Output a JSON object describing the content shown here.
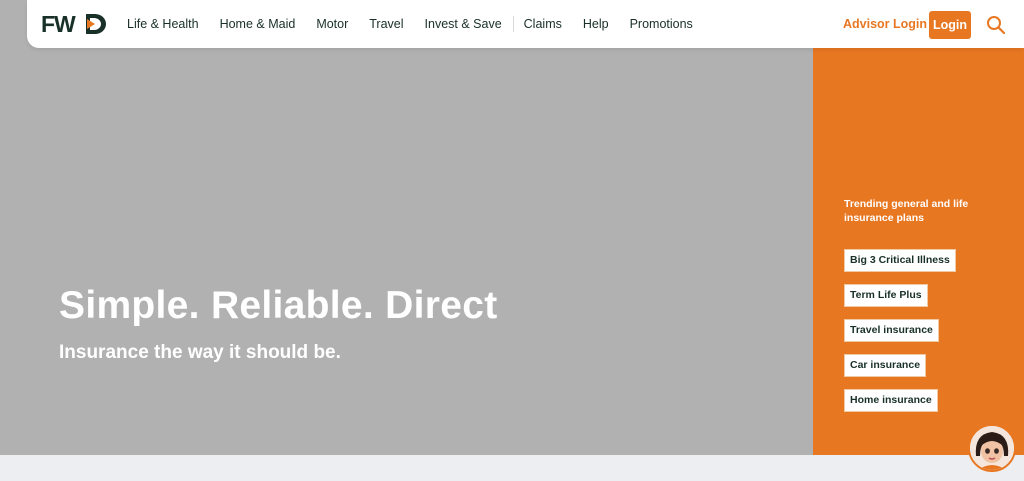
{
  "brand": {
    "logo_text": "FWD",
    "accent": "#e87722",
    "dark": "#183028"
  },
  "nav": {
    "items": [
      "Life & Health",
      "Home & Maid",
      "Motor",
      "Travel",
      "Invest & Save",
      "Claims",
      "Help",
      "Promotions"
    ]
  },
  "header": {
    "advisor_login": "Advisor Login",
    "login": "Login",
    "search_icon": "search-icon"
  },
  "hero": {
    "headline": "Simple. Reliable. Direct",
    "subline": "Insurance the way it should be."
  },
  "trending": {
    "title": "Trending general and life insurance plans",
    "items": [
      "Big 3 Critical Illness",
      "Term Life Plus",
      "Travel insurance",
      "Car insurance",
      "Home insurance"
    ]
  },
  "chat": {
    "avatar_icon": "chat-avatar-icon"
  }
}
